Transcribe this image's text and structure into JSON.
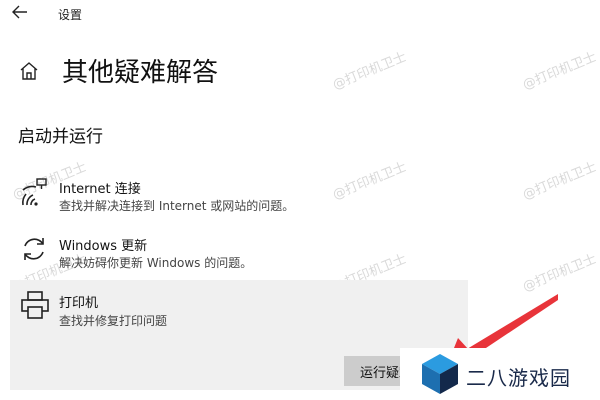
{
  "titlebar": {
    "back_icon": "back-arrow-icon",
    "title": "设置"
  },
  "page": {
    "home_icon": "home-icon",
    "title": "其他疑难解答"
  },
  "section": {
    "heading": "启动并运行"
  },
  "items": [
    {
      "icon": "wifi-icon",
      "name": "Internet 连接",
      "description": "查找并解决连接到 Internet 或网站的问题。"
    },
    {
      "icon": "refresh-icon",
      "name": "Windows 更新",
      "description": "解决妨碍你更新 Windows 的问题。"
    },
    {
      "icon": "printer-icon",
      "name": "打印机",
      "description": "查找并修复打印问题",
      "button": "运行疑难解答",
      "selected": true
    }
  ],
  "watermark": {
    "text": "@打印机卫士"
  },
  "overlay": {
    "arrow_color": "#e8343a",
    "logo_icon": "cube-logo-icon",
    "site_name": "二八游戏园"
  }
}
